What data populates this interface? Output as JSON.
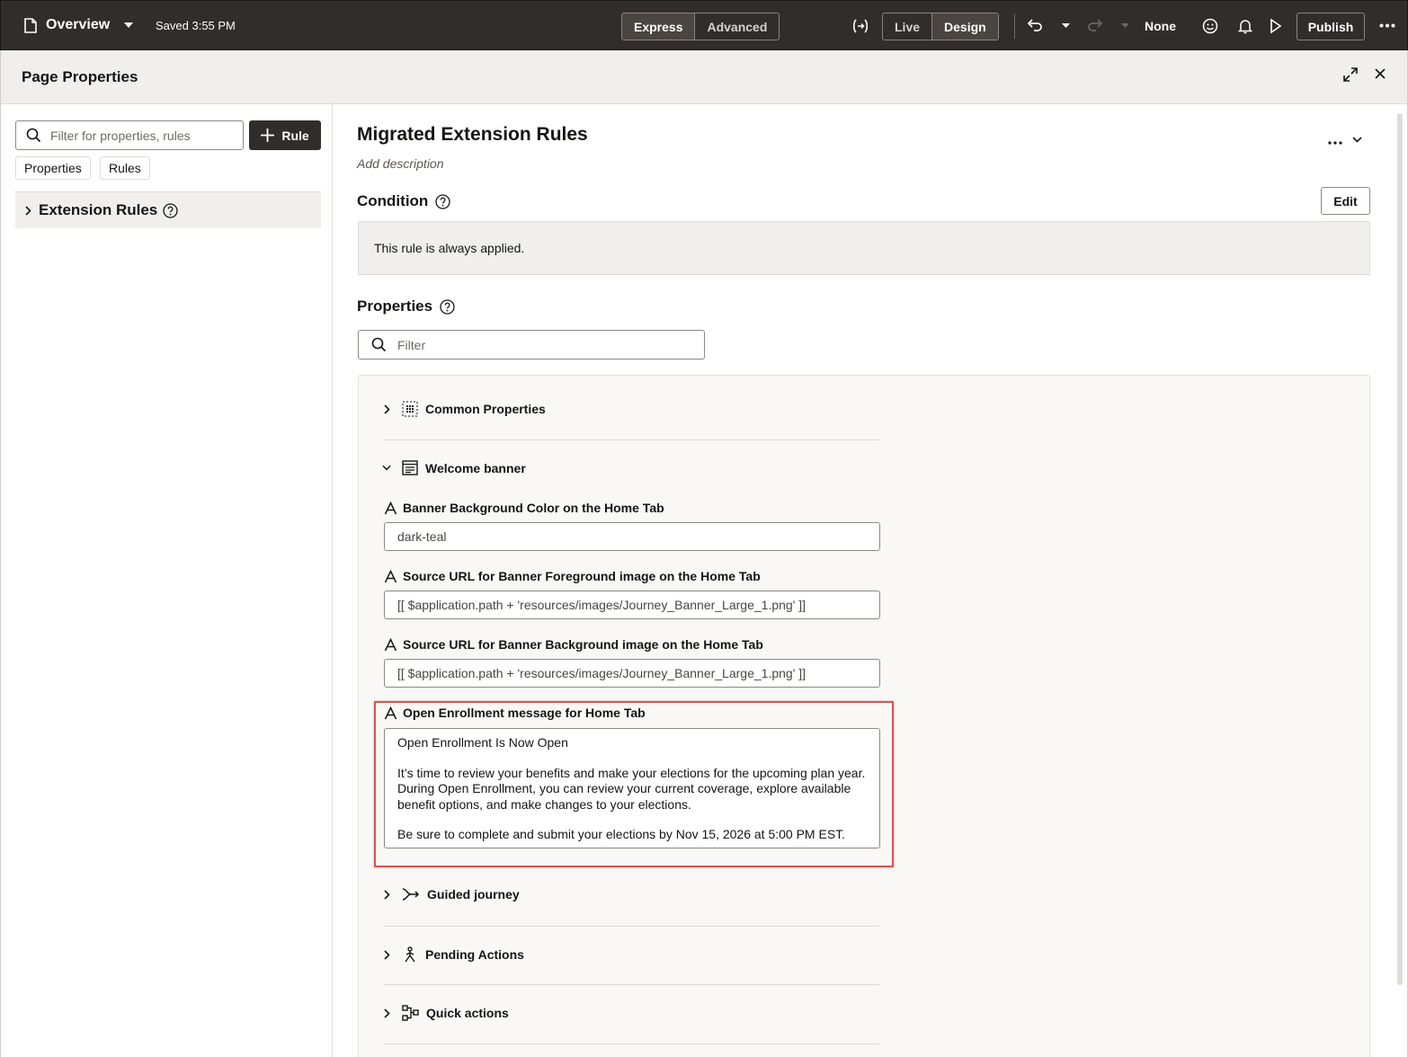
{
  "topbar": {
    "page_name": "Overview",
    "saved_status": "Saved 3:55 PM",
    "mode_tabs": [
      "Express",
      "Advanced"
    ],
    "view_tabs": [
      "Live",
      "Design"
    ],
    "sandbox": "None",
    "publish_label": "Publish"
  },
  "panel": {
    "title": "Page Properties"
  },
  "left": {
    "filter_placeholder": "Filter for properties, rules",
    "rule_button": "Rule",
    "chips": [
      "Properties",
      "Rules"
    ],
    "extension_rules_label": "Extension Rules"
  },
  "main": {
    "rule_title": "Migrated Extension Rules",
    "add_description": "Add description",
    "condition_heading": "Condition",
    "edit_label": "Edit",
    "condition_text": "This rule is always applied.",
    "properties_heading": "Properties",
    "properties_filter_placeholder": "Filter"
  },
  "groups": {
    "common": "Common Properties",
    "welcome": "Welcome banner",
    "guided": "Guided journey",
    "pending": "Pending Actions",
    "quick": "Quick actions"
  },
  "fields": [
    {
      "label": "Banner Background Color on the Home Tab",
      "value": "dark-teal"
    },
    {
      "label": "Source URL for Banner Foreground image on the Home Tab",
      "value": "[[ $application.path + 'resources/images/Journey_Banner_Large_1.png' ]]"
    },
    {
      "label": "Source URL for Banner Background image on the Home Tab",
      "value": "[[ $application.path + 'resources/images/Journey_Banner_Large_1.png' ]]"
    }
  ],
  "enrollment": {
    "label": "Open Enrollment message for Home Tab",
    "heading": "Open Enrollment Is Now Open",
    "paragraph": "It’s time to review your benefits and make your elections for the upcoming plan year. During Open Enrollment, you can review your current coverage, explore available benefit options, and make changes to your elections.",
    "deadline": "Be sure to complete and submit your elections by Nov 15, 2026 at 5:00 PM EST."
  },
  "colors": {
    "topbar_bg": "#312d2a",
    "highlight": "#d9534f"
  }
}
